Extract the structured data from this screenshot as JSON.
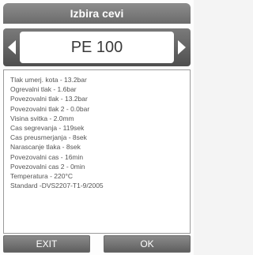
{
  "title": "Izbira cevi",
  "selector": {
    "value": "PE 100",
    "left_icon": "triangle-left-icon",
    "right_icon": "triangle-right-icon"
  },
  "info_lines": [
    "Tlak umerj. kota - 13.2bar",
    "Ogrevalni tlak - 1.6bar",
    "Povezovalni tlak - 13.2bar",
    "Povezovalni tlak 2 - 0.0bar",
    "Visina svitka - 2.0mm",
    "Cas segrevanja - 119sek",
    "Cas preusmerjanja - 8sek",
    "Narascanje tlaka - 8sek",
    "Povezovalni cas - 16min",
    "Povezovalni cas 2 - 0min",
    "Temperatura - 220°C",
    "Standard -DVS2207-T1-9/2005"
  ],
  "buttons": {
    "exit": "EXIT",
    "ok": "OK"
  },
  "colors": {
    "bar": "#6f6f6f",
    "text": "#555555"
  }
}
